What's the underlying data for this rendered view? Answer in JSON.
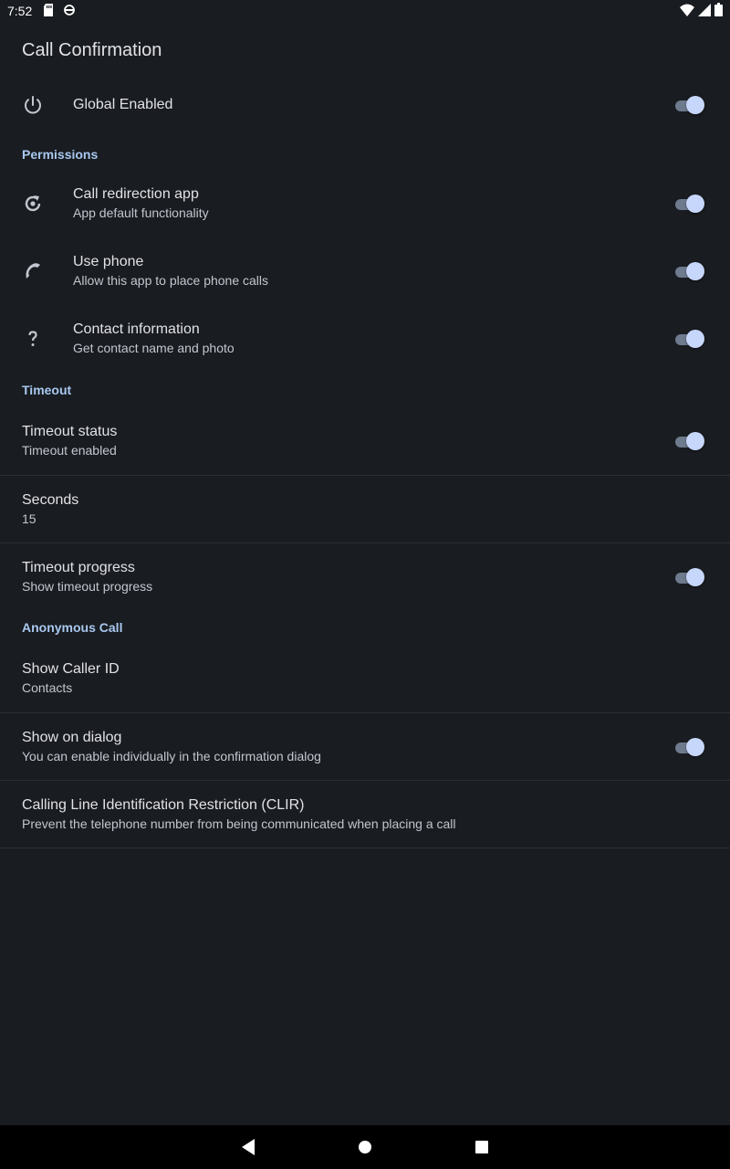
{
  "status_bar": {
    "time": "7:52",
    "left_icons": [
      "sd-card-icon",
      "sync-icon"
    ],
    "right_icons": [
      "wifi-icon",
      "signal-icon",
      "battery-icon"
    ]
  },
  "app_bar": {
    "title": "Call Confirmation"
  },
  "global": {
    "title": "Global Enabled",
    "icon": "power-icon",
    "enabled": true
  },
  "permissions": {
    "header": "Permissions",
    "items": [
      {
        "title": "Call redirection app",
        "summary": "App default functionality",
        "icon": "redirect-icon",
        "enabled": true
      },
      {
        "title": "Use phone",
        "summary": "Allow this app to place phone calls",
        "icon": "phone-icon",
        "enabled": true
      },
      {
        "title": "Contact information",
        "summary": "Get contact name and photo",
        "icon": "question-icon",
        "enabled": true
      }
    ]
  },
  "timeout": {
    "header": "Timeout",
    "status": {
      "title": "Timeout status",
      "summary": "Timeout enabled",
      "enabled": true
    },
    "seconds": {
      "title": "Seconds",
      "summary": "15"
    },
    "progress": {
      "title": "Timeout progress",
      "summary": "Show timeout progress",
      "enabled": true
    }
  },
  "anonymous": {
    "header": "Anonymous Call",
    "caller_id": {
      "title": "Show Caller ID",
      "summary": "Contacts"
    },
    "dialog": {
      "title": "Show on dialog",
      "summary": "You can enable individually in the confirmation dialog",
      "enabled": true
    },
    "clir": {
      "title": "Calling Line Identification Restriction (CLIR)",
      "summary": "Prevent the telephone number from being communicated when placing a call"
    }
  },
  "nav_bar": {
    "buttons": [
      "back-icon",
      "home-icon",
      "recents-icon"
    ]
  },
  "colors": {
    "background": "#191c20",
    "accent": "#a8c8f0",
    "switch_thumb": "#c7d7fb",
    "switch_track": "#6e7a8e"
  }
}
